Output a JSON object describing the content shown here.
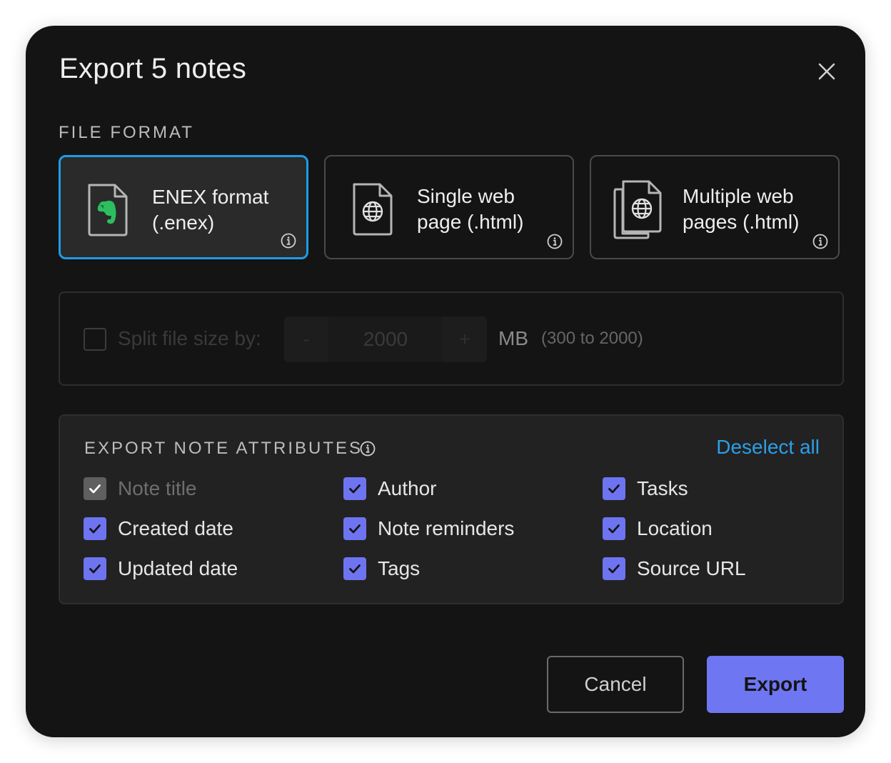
{
  "dialog": {
    "title": "Export 5 notes",
    "close_icon": "close-icon"
  },
  "file_format": {
    "label": "FILE FORMAT",
    "options": [
      {
        "line1": "ENEX format",
        "line2": "(.enex)",
        "icon": "evernote-file-icon",
        "selected": true
      },
      {
        "line1": "Single web",
        "line2": "page (.html)",
        "icon": "web-page-icon",
        "selected": false
      },
      {
        "line1": "Multiple web",
        "line2": "pages (.html)",
        "icon": "multiple-web-pages-icon",
        "selected": false
      }
    ],
    "info_icon": "info-icon"
  },
  "split": {
    "checked": false,
    "disabled": true,
    "label": "Split file size by:",
    "minus": "-",
    "value": "2000",
    "plus": "+",
    "unit": "MB",
    "range": "(300 to 2000)"
  },
  "attributes": {
    "label": "EXPORT NOTE ATTRIBUTES",
    "deselect_all": "Deselect all",
    "items": [
      {
        "label": "Note title",
        "checked": true,
        "disabled": true
      },
      {
        "label": "Created date",
        "checked": true,
        "disabled": false
      },
      {
        "label": "Updated date",
        "checked": true,
        "disabled": false
      },
      {
        "label": "Author",
        "checked": true,
        "disabled": false
      },
      {
        "label": "Note reminders",
        "checked": true,
        "disabled": false
      },
      {
        "label": "Tags",
        "checked": true,
        "disabled": false
      },
      {
        "label": "Tasks",
        "checked": true,
        "disabled": false
      },
      {
        "label": "Location",
        "checked": true,
        "disabled": false
      },
      {
        "label": "Source URL",
        "checked": true,
        "disabled": false
      }
    ]
  },
  "footer": {
    "cancel": "Cancel",
    "export": "Export"
  },
  "colors": {
    "background": "#141414",
    "accent": "#6f76f2",
    "selected_border": "#1f9be8",
    "link": "#2d9ee6",
    "evernote_green": "#2dbe60"
  }
}
